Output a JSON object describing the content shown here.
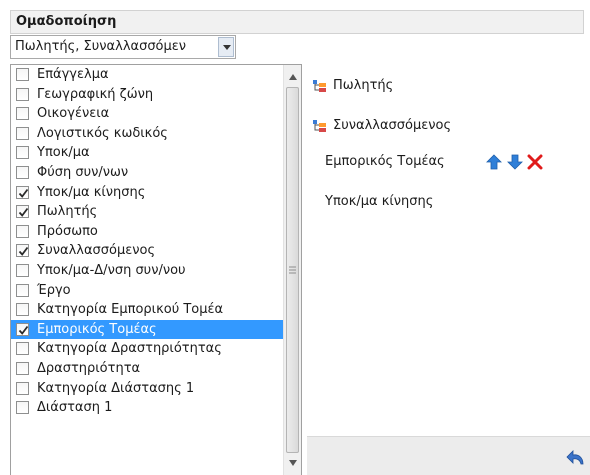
{
  "panel": {
    "title": "Ομαδοποίηση",
    "group_selector": {
      "value": "Πωλητής, Συναλλασσόμεν"
    }
  },
  "field_list": {
    "items": [
      {
        "label": "Επάγγελμα",
        "checked": false,
        "selected": false
      },
      {
        "label": "Γεωγραφική ζώνη",
        "checked": false,
        "selected": false
      },
      {
        "label": "Οικογένεια",
        "checked": false,
        "selected": false
      },
      {
        "label": "Λογιστικός κωδικός",
        "checked": false,
        "selected": false
      },
      {
        "label": "Υποκ/μα",
        "checked": false,
        "selected": false
      },
      {
        "label": "Φύση συν/νων",
        "checked": false,
        "selected": false
      },
      {
        "label": "Υποκ/μα κίνησης",
        "checked": true,
        "selected": false
      },
      {
        "label": "Πωλητής",
        "checked": true,
        "selected": false
      },
      {
        "label": "Πρόσωπο",
        "checked": false,
        "selected": false
      },
      {
        "label": "Συναλλασσόμενος",
        "checked": true,
        "selected": false
      },
      {
        "label": "Υποκ/μα-Δ/νση συν/νου",
        "checked": false,
        "selected": false
      },
      {
        "label": "Έργο",
        "checked": false,
        "selected": false
      },
      {
        "label": "Κατηγορία Εμπορικού Τομέα",
        "checked": false,
        "selected": false
      },
      {
        "label": "Εμπορικός Τομέας",
        "checked": true,
        "selected": true
      },
      {
        "label": "Κατηγορία Δραστηριότητας",
        "checked": false,
        "selected": false
      },
      {
        "label": "Δραστηριότητα",
        "checked": false,
        "selected": false
      },
      {
        "label": "Κατηγορία Διάστασης 1",
        "checked": false,
        "selected": false
      },
      {
        "label": "Διάσταση 1",
        "checked": false,
        "selected": false
      }
    ]
  },
  "grouping_tree": {
    "levels": [
      {
        "label": "Πωλητής",
        "icon": "hierarchy-icon"
      },
      {
        "label": "Συναλλασσόμενος",
        "icon": "hierarchy-icon"
      }
    ],
    "children": [
      {
        "label": "Εμπορικός Τομέας"
      },
      {
        "label": "Υποκ/μα κίνησης"
      }
    ]
  },
  "actions": {
    "icons": [
      "move-up-icon",
      "move-down-icon",
      "remove-icon",
      "undo-icon"
    ]
  },
  "colors": {
    "selection": "#3399ff",
    "move_arrow": "#2f7fd8",
    "remove": "#e01b1b"
  }
}
